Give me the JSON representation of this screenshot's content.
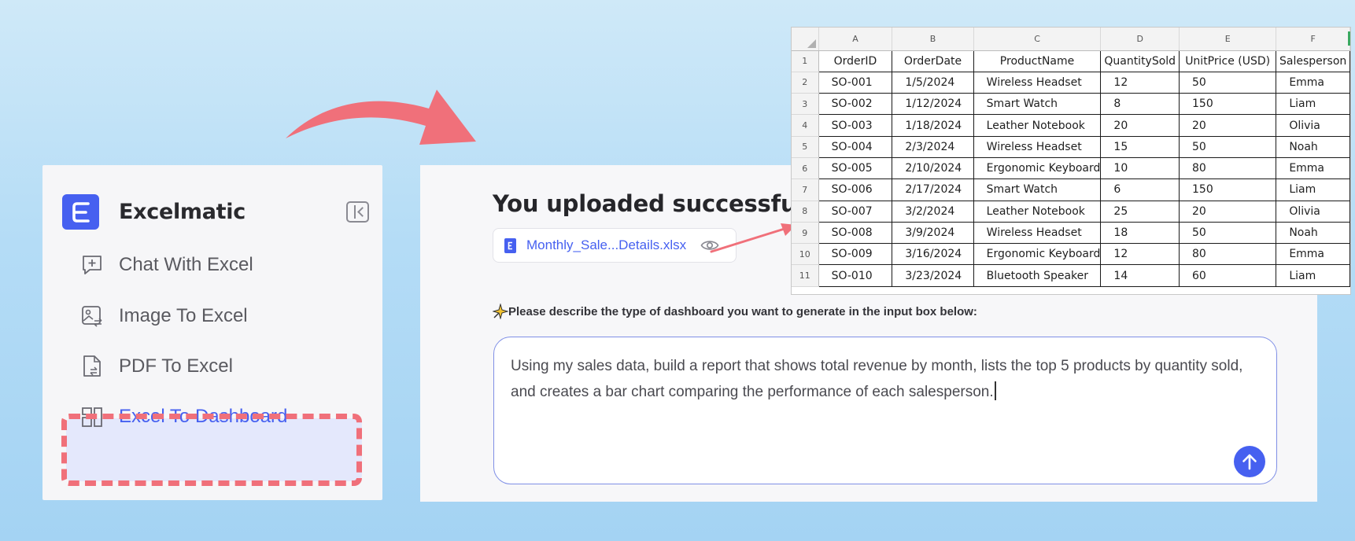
{
  "sidebar": {
    "brand": {
      "name": "Excelmatic",
      "logo_glyph": "ε",
      "color": "#4660f0"
    },
    "items": [
      {
        "label": "Chat With Excel",
        "icon": "chat-plus-icon"
      },
      {
        "label": "Image To Excel",
        "icon": "image-convert-icon"
      },
      {
        "label": "PDF To Excel",
        "icon": "pdf-convert-icon"
      },
      {
        "label": "Excel To Dashboard",
        "icon": "dashboard-icon",
        "active": true
      }
    ],
    "highlight_color": "#f0707a"
  },
  "main": {
    "title": "You uploaded successfully",
    "file": {
      "name": "Monthly_Sale...Details.xlsx",
      "icon": "xlsx-file-icon",
      "preview_icon": "eye-icon"
    },
    "prompt_label": "Please describe the type of dashboard you want to generate in the input box below:",
    "prompt_label_icon": "sparkle-icon",
    "prompt_text": "Using my sales data, build a report that shows total revenue by month, lists the top 5 products by quantity sold, and creates a bar chart comparing the performance of each salesperson.",
    "send_icon": "arrow-up-icon"
  },
  "spreadsheet": {
    "column_letters": [
      "A",
      "B",
      "C",
      "D",
      "E",
      "F"
    ],
    "headers": [
      "OrderID",
      "OrderDate",
      "ProductName",
      "QuantitySold",
      "UnitPrice (USD)",
      "Salesperson"
    ],
    "rows": [
      [
        "SO-001",
        "1/5/2024",
        "Wireless Headset",
        "12",
        "50",
        "Emma"
      ],
      [
        "SO-002",
        "1/12/2024",
        "Smart Watch",
        "8",
        "150",
        "Liam"
      ],
      [
        "SO-003",
        "1/18/2024",
        "Leather Notebook",
        "20",
        "20",
        "Olivia"
      ],
      [
        "SO-004",
        "2/3/2024",
        "Wireless Headset",
        "15",
        "50",
        "Noah"
      ],
      [
        "SO-005",
        "2/10/2024",
        "Ergonomic Keyboard",
        "10",
        "80",
        "Emma"
      ],
      [
        "SO-006",
        "2/17/2024",
        "Smart Watch",
        "6",
        "150",
        "Liam"
      ],
      [
        "SO-007",
        "3/2/2024",
        "Leather Notebook",
        "25",
        "20",
        "Olivia"
      ],
      [
        "SO-008",
        "3/9/2024",
        "Wireless Headset",
        "18",
        "50",
        "Noah"
      ],
      [
        "SO-009",
        "3/16/2024",
        "Ergonomic Keyboard",
        "12",
        "80",
        "Emma"
      ],
      [
        "SO-010",
        "3/23/2024",
        "Bluetooth Speaker",
        "14",
        "60",
        "Liam"
      ]
    ]
  },
  "colors": {
    "accent": "#4660f0",
    "arrow": "#f0707a",
    "background": "#b4dcf6"
  }
}
